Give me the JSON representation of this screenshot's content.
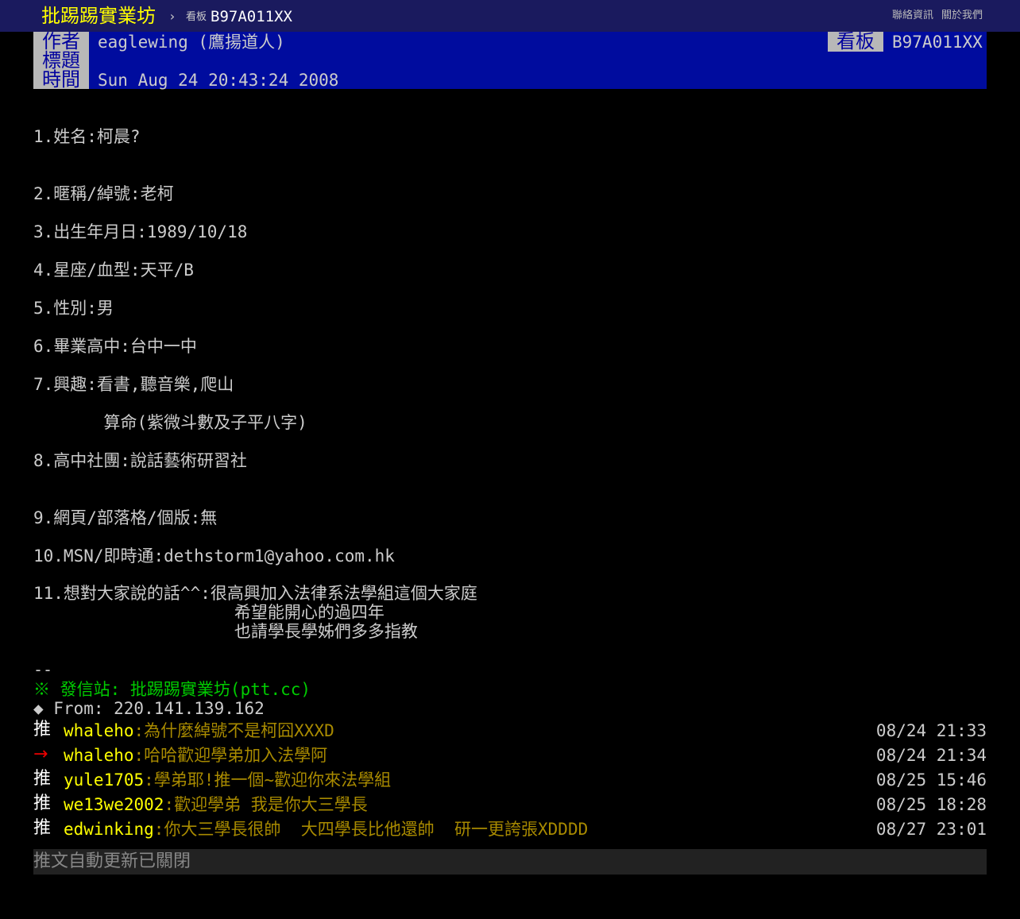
{
  "topbar": {
    "site_title": "批踢踢實業坊",
    "separator": "›",
    "board_label": "看板",
    "board_name": "B97A011XX",
    "links": [
      "聯絡資訊",
      "關於我們"
    ]
  },
  "meta": {
    "author_key": "作者",
    "author_value": "eaglewing (鷹揚道人)",
    "title_key": "標題",
    "time_key": "時間",
    "time_value": "Sun Aug 24 20:43:24 2008",
    "board_key": "看板",
    "board_value": "B97A011XX"
  },
  "body_lines": [
    "1.姓名:柯晨?",
    "2.暱稱/綽號:老柯",
    "3.出生年月日:1989/10/18",
    "4.星座/血型:天平/B",
    "5.性別:男",
    "6.畢業高中:台中一中",
    "7.興趣:看書,聽音樂,爬山",
    "       算命(紫微斗數及子平八字)",
    "8.高中社團:說話藝術研習社",
    "9.網頁/部落格/個版:無",
    "10.MSN/即時通:dethstorm1@yahoo.com.hk",
    "11.想對大家說的話^^:很高興加入法律系法學組這個大家庭",
    "                    希望能開心的過四年",
    "                    也請學長學姊們多多指教"
  ],
  "signature": {
    "separator": "--",
    "station": "※ 發信站: 批踢踢實業坊(ptt.cc)",
    "from": "◆ From: 220.141.139.162"
  },
  "pushes": [
    {
      "tag": "推",
      "user": "whaleho",
      "content": ":為什麼綽號不是柯囧XXXD",
      "time": "08/24 21:33"
    },
    {
      "tag": "→",
      "user": "whaleho",
      "content": ":哈哈歡迎學弟加入法學阿",
      "time": "08/24 21:34"
    },
    {
      "tag": "推",
      "user": "yule1705",
      "content": ":學弟耶!推一個~歡迎你來法學組",
      "time": "08/25 15:46"
    },
    {
      "tag": "推",
      "user": "we13we2002",
      "content": ":歡迎學弟 我是你大三學長",
      "time": "08/25 18:28"
    },
    {
      "tag": "推",
      "user": "edwinking",
      "content": ":你大三學長很帥  大四學長比他還帥  研一更誇張XDDDD",
      "time": "08/27 23:01"
    }
  ],
  "auto_update_text": "推文自動更新已關閉",
  "colors": {
    "topbar_bg": "#1a1a5e",
    "site_title": "#ffff00",
    "meta_bg": "#000c9e",
    "meta_key_bg": "#b8b8b8",
    "station": "#00cc00",
    "push_user": "#ffff00",
    "push_text": "#a88a00",
    "arrow_tag": "#ee0000"
  }
}
